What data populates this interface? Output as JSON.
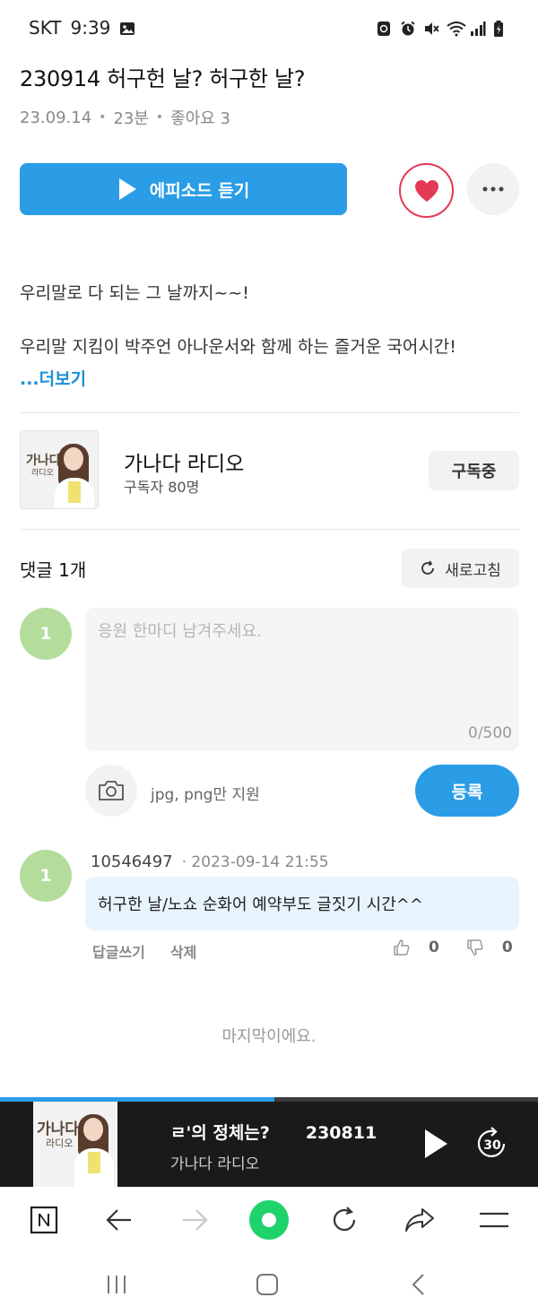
{
  "status_bar": {
    "carrier": "SKT",
    "time": "9:39"
  },
  "episode": {
    "title": "230914 허구헌 날? 허구한 날?",
    "date": "23.09.14",
    "duration": "23분",
    "likes": "좋아요 3",
    "play_label": "에피소드 듣기",
    "description_line1": "우리말로 다 되는 그 날까지~~!",
    "description_line2": "우리말 지킴이 박주언 아나운서와 함께 하는 즐거운 국어시간!",
    "more_label": "...더보기"
  },
  "channel": {
    "name": "가나다 라디오",
    "subscribers": "구독자 80명",
    "subscribe_label": "구독중",
    "thumb_title": "가나다",
    "thumb_sub": "라디오"
  },
  "comments": {
    "header": "댓글 1개",
    "refresh_label": "새로고침",
    "my_avatar": "1",
    "placeholder": "응원 한마디 남겨주세요.",
    "char_count": "0/500",
    "image_hint": "jpg, png만 지원",
    "submit_label": "등록",
    "items": [
      {
        "avatar": "1",
        "user": "10546497",
        "date": "· 2023-09-14 21:55",
        "text": "허구한 날/노쇼 순화어 예약부도 글짓기 시간^^",
        "reply_label": "답글쓰기",
        "delete_label": "삭제",
        "likes": "0",
        "dislikes": "0"
      }
    ],
    "end_label": "마지막이에요."
  },
  "player": {
    "track_title": "ㄹ'의 정체는?",
    "track_number": "230811",
    "channel": "가나다 라디오",
    "skip_label": "30",
    "progress": 0.51
  },
  "colors": {
    "accent": "#2a9de6",
    "heart": "#e33a55",
    "avatar": "#b4dd9c",
    "bubble": "#e8f4fd",
    "nav_green": "#1ed36b"
  }
}
